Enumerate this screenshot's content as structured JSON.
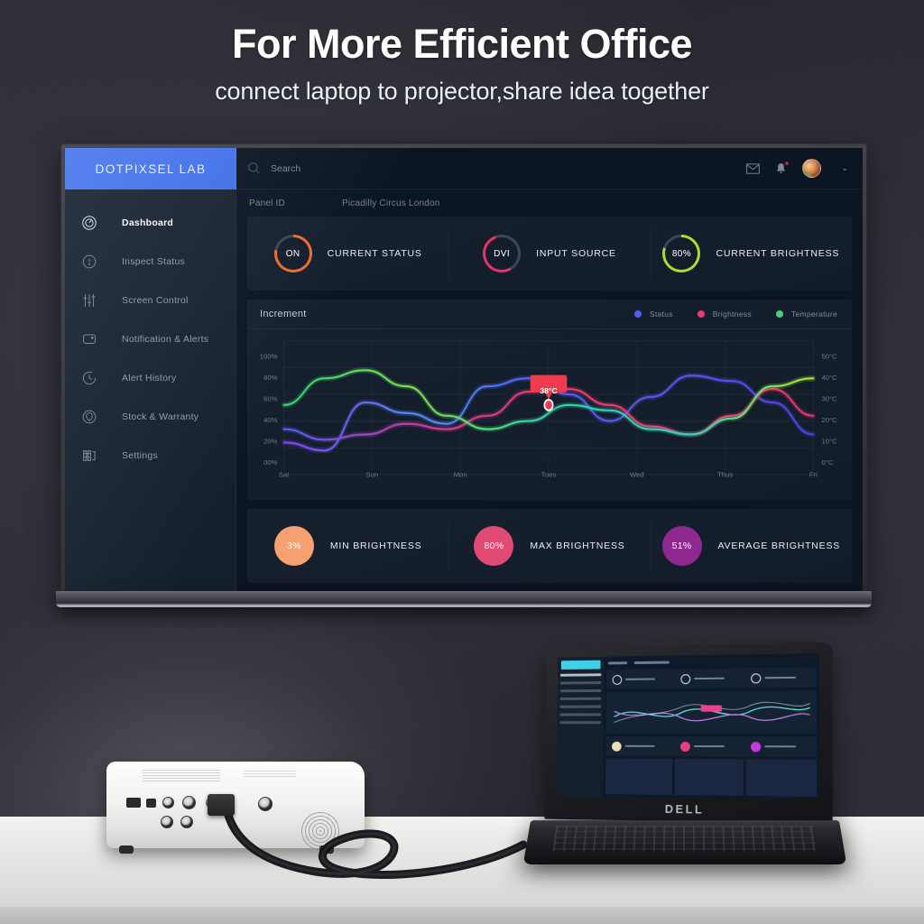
{
  "promo": {
    "headline": "For More Efficient Office",
    "subhead": "connect laptop to projector,share idea together"
  },
  "dashboard": {
    "brand": "DOTPIXSEL LAB",
    "sidebar": {
      "items": [
        {
          "label": "Dashboard",
          "icon": "gauge-icon",
          "active": true
        },
        {
          "label": "Inspect Status",
          "icon": "info-circle-icon",
          "active": false
        },
        {
          "label": "Screen Control",
          "icon": "sliders-icon",
          "active": false
        },
        {
          "label": "Notification & Alerts",
          "icon": "chat-bubble-icon",
          "active": false
        },
        {
          "label": "Alert History",
          "icon": "clock-history-icon",
          "active": false
        },
        {
          "label": "Stock & Warranty",
          "icon": "shield-icon",
          "active": false
        },
        {
          "label": "Settings",
          "icon": "equalizer-icon",
          "active": false
        }
      ]
    },
    "topbar": {
      "search_placeholder": "Search",
      "search_value": "",
      "mail_icon": "mail-icon",
      "bell_icon": "bell-icon",
      "has_notification": true,
      "chevron": "⌄"
    },
    "panel": {
      "id_label": "Panel ID",
      "id_value": "Picadilly Circus London"
    },
    "stats": [
      {
        "value": "ON",
        "label": "CURRENT STATUS",
        "color": "#ef6c2b",
        "pct": 78
      },
      {
        "value": "DVI",
        "label": "INPUT SOURCE",
        "color": "#e8336a",
        "pct": 52
      },
      {
        "value": "80%",
        "label": "CURRENT BRIGHTNESS",
        "color": "#a8e02c",
        "pct": 80
      }
    ],
    "brightness": [
      {
        "value": "3%",
        "label": "MIN BRIGHTNESS",
        "color": "#f7a072"
      },
      {
        "value": "80%",
        "label": "MAX BRIGHTNESS",
        "color": "#e04a73"
      },
      {
        "value": "51%",
        "label": "AVERAGE BRIGHTNESS",
        "color": "#8e2a8f"
      }
    ],
    "tooltip": {
      "text": "38°C",
      "color": "#ee3b4f"
    }
  },
  "chart_data": {
    "type": "line",
    "title": "Increment",
    "xlabel": "",
    "ylabel": "",
    "categories": [
      "Sat",
      "Sun",
      "Mon",
      "Tues",
      "Wed",
      "Thus",
      "Fri"
    ],
    "y_left_ticks": [
      "100%",
      "80%",
      "60%",
      "40%",
      "20%",
      "00%"
    ],
    "y_right_ticks": [
      "50°C",
      "40°C",
      "30°C",
      "20°C",
      "10°C",
      "0°C"
    ],
    "ylim": [
      0,
      100
    ],
    "y2lim": [
      0,
      50
    ],
    "grid": true,
    "legend_position": "top-right",
    "annotation": {
      "text": "38°C",
      "x_category": "Tues",
      "y": 52
    },
    "series": [
      {
        "name": "Status",
        "color": "#4f5df5",
        "values": [
          24,
          18,
          54,
          46,
          38,
          66,
          72,
          60,
          40,
          58,
          74,
          70,
          54,
          30
        ]
      },
      {
        "name": "Brightness",
        "color": "#ec3a6d",
        "values": [
          34,
          26,
          30,
          38,
          34,
          44,
          62,
          64,
          52,
          36,
          30,
          44,
          64,
          44
        ]
      },
      {
        "name": "Temperature",
        "color": "#46d07a",
        "values": [
          52,
          72,
          78,
          66,
          44,
          34,
          40,
          52,
          48,
          34,
          30,
          42,
          66,
          72
        ]
      }
    ]
  },
  "laptop": {
    "brand": "DELL"
  }
}
